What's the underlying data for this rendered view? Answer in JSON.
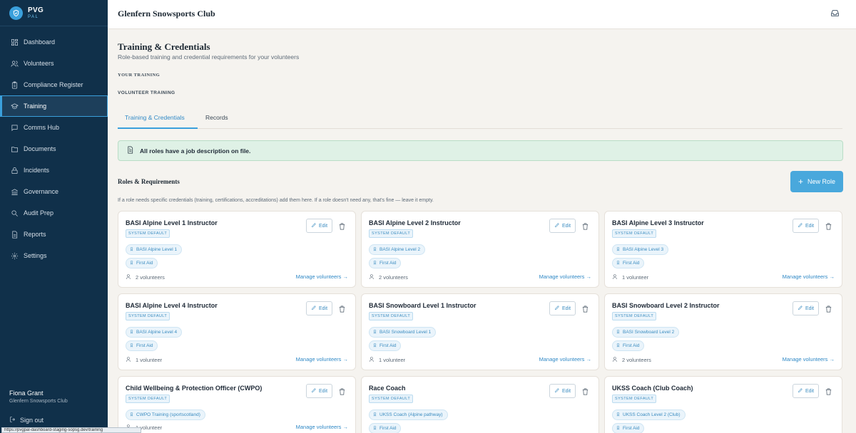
{
  "brand": {
    "title": "PVG",
    "subtitle": "PAL"
  },
  "sidebar": {
    "items": [
      {
        "label": "Dashboard",
        "icon": "dashboard-icon"
      },
      {
        "label": "Volunteers",
        "icon": "users-icon"
      },
      {
        "label": "Compliance Register",
        "icon": "clipboard-icon"
      },
      {
        "label": "Training",
        "icon": "graduation-cap-icon",
        "active": true
      },
      {
        "label": "Comms Hub",
        "icon": "chat-icon"
      },
      {
        "label": "Documents",
        "icon": "folder-icon"
      },
      {
        "label": "Incidents",
        "icon": "lock-icon"
      },
      {
        "label": "Governance",
        "icon": "building-icon"
      },
      {
        "label": "Audit Prep",
        "icon": "search-icon"
      },
      {
        "label": "Reports",
        "icon": "report-icon"
      },
      {
        "label": "Settings",
        "icon": "gear-icon"
      }
    ],
    "user_name": "Fiona Grant",
    "user_org": "Glenfern Snowsports Club",
    "signout_label": "Sign out",
    "url_tooltip": "https://pvgpal-dashboard-staging-sopsg.dev/training"
  },
  "topbar": {
    "title": "Glenfern Snowsports Club",
    "icon": "inbox-icon"
  },
  "page": {
    "title": "Training & Credentials",
    "subtitle": "Role-based training and credential requirements for your volunteers",
    "section_your": "YOUR TRAINING",
    "section_volunteer": "VOLUNTEER TRAINING",
    "tabs": [
      {
        "label": "Training & Credentials",
        "active": true
      },
      {
        "label": "Records"
      }
    ],
    "banner_text": "All roles have a job description on file.",
    "roles_title": "Roles & Requirements",
    "roles_help": "If a role needs specific credentials (training, certifications, accreditations) add them here. If a role doesn't need any, that's fine — leave it empty.",
    "new_role_label": "New Role"
  },
  "card_labels": {
    "edit": "Edit",
    "manage": "Manage volunteers →"
  },
  "roles": [
    {
      "title": "BASI Alpine Level 1 Instructor",
      "badge": "SYSTEM DEFAULT",
      "credentials": [
        "BASI Alpine Level 1",
        "First Aid"
      ],
      "volunteers": "2 volunteers"
    },
    {
      "title": "BASI Alpine Level 2 Instructor",
      "badge": "SYSTEM DEFAULT",
      "credentials": [
        "BASI Alpine Level 2",
        "First Aid"
      ],
      "volunteers": "2 volunteers"
    },
    {
      "title": "BASI Alpine Level 3 Instructor",
      "badge": "SYSTEM DEFAULT",
      "credentials": [
        "BASI Alpine Level 3",
        "First Aid"
      ],
      "volunteers": "1 volunteer"
    },
    {
      "title": "BASI Alpine Level 4 Instructor",
      "badge": "SYSTEM DEFAULT",
      "credentials": [
        "BASI Alpine Level 4",
        "First Aid"
      ],
      "volunteers": "1 volunteer"
    },
    {
      "title": "BASI Snowboard Level 1 Instructor",
      "badge": "SYSTEM DEFAULT",
      "credentials": [
        "BASI Snowboard Level 1",
        "First Aid"
      ],
      "volunteers": "1 volunteer"
    },
    {
      "title": "BASI Snowboard Level 2 Instructor",
      "badge": "SYSTEM DEFAULT",
      "credentials": [
        "BASI Snowboard Level 2",
        "First Aid"
      ],
      "volunteers": "2 volunteers"
    },
    {
      "title": "Child Wellbeing & Protection Officer (CWPO)",
      "badge": "SYSTEM DEFAULT",
      "credentials": [
        "CWPO Training (sportscotland)"
      ],
      "volunteers": "1 volunteer"
    },
    {
      "title": "Race Coach",
      "badge": "SYSTEM DEFAULT",
      "credentials": [
        "UKSS Coach (Alpine pathway)",
        "First Aid"
      ],
      "volunteers": ""
    },
    {
      "title": "UKSS Coach (Club Coach)",
      "badge": "SYSTEM DEFAULT",
      "credentials": [
        "UKSS Coach Level 2 (Club)",
        "First Aid"
      ],
      "volunteers": ""
    }
  ]
}
